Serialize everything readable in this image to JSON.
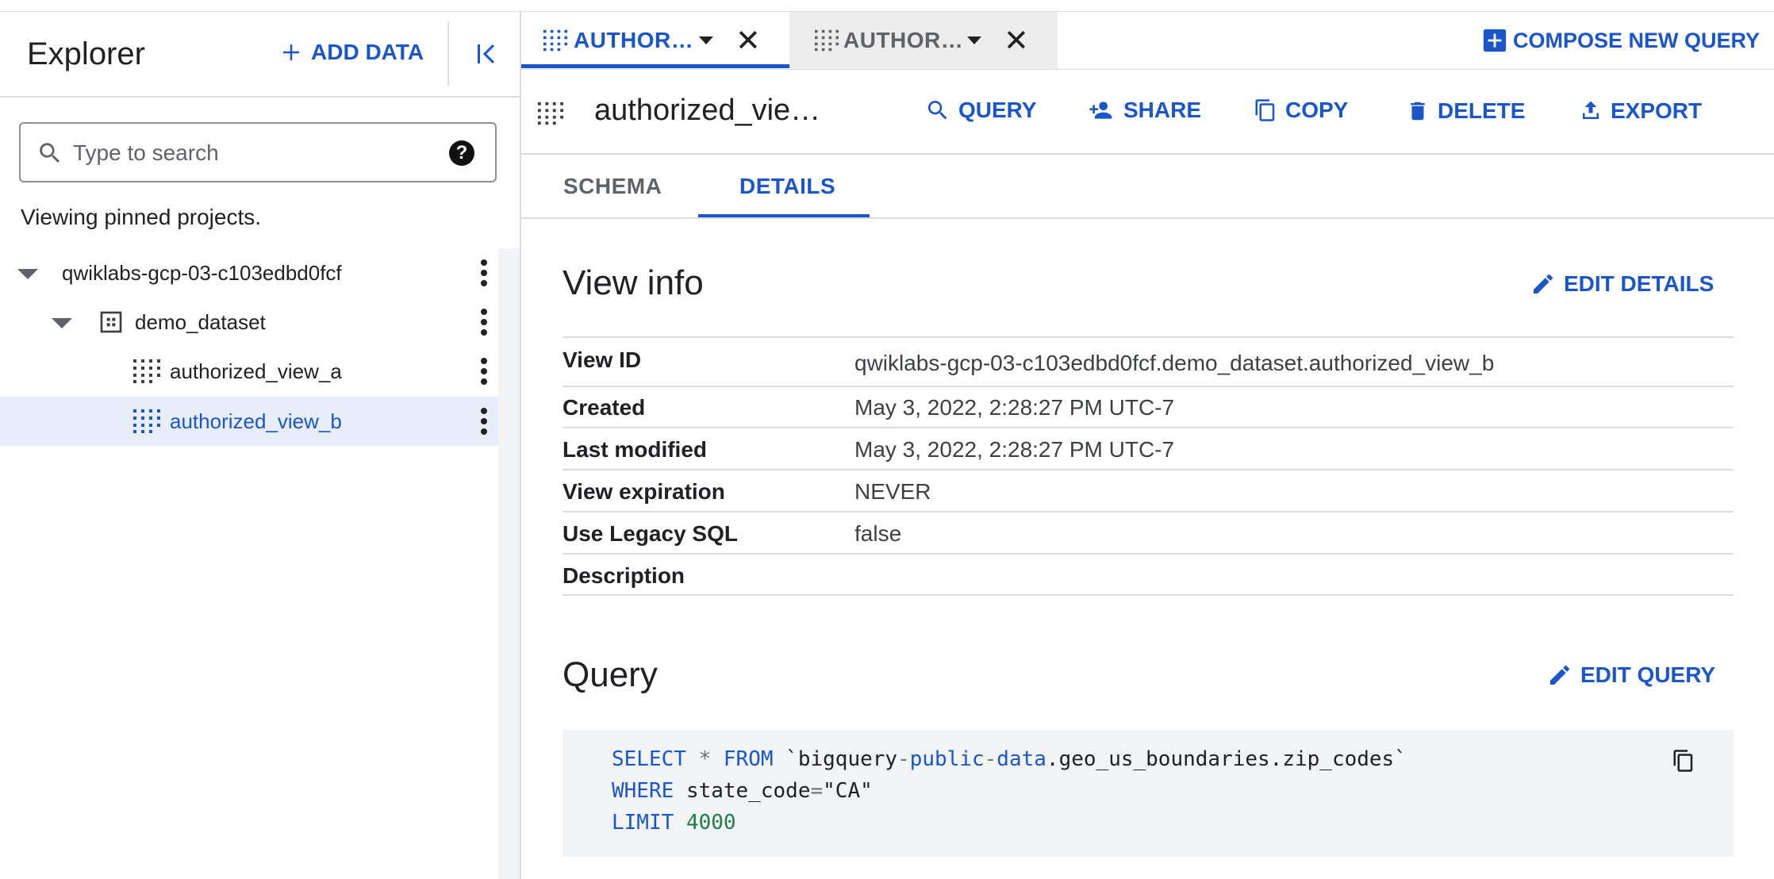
{
  "explorer": {
    "title": "Explorer",
    "add_data_label": "ADD DATA",
    "search_placeholder": "Type to search",
    "help_glyph": "?",
    "viewing_text": "Viewing pinned projects.",
    "tree": [
      {
        "label": "qwiklabs-gcp-03-c103edbd0fcf",
        "type": "project",
        "expanded": true
      },
      {
        "label": "demo_dataset",
        "type": "dataset",
        "expanded": true
      },
      {
        "label": "authorized_view_a",
        "type": "view",
        "selected": false
      },
      {
        "label": "authorized_view_b",
        "type": "view",
        "selected": true
      }
    ]
  },
  "tabs": [
    {
      "label": "AUTHOR…",
      "active": true
    },
    {
      "label": "AUTHOR…",
      "active": false
    }
  ],
  "close_glyph": "✕",
  "compose_label": "COMPOSE NEW QUERY",
  "toolbar": {
    "title": "authorized_vie…",
    "buttons": [
      {
        "label": "QUERY",
        "icon": "search-icon"
      },
      {
        "label": "SHARE",
        "icon": "person-add-icon"
      },
      {
        "label": "COPY",
        "icon": "copy-icon"
      },
      {
        "label": "DELETE",
        "icon": "trash-icon"
      },
      {
        "label": "EXPORT",
        "icon": "upload-icon"
      }
    ]
  },
  "subtabs": [
    {
      "label": "SCHEMA",
      "active": false
    },
    {
      "label": "DETAILS",
      "active": true
    }
  ],
  "view_info": {
    "title": "View info",
    "edit_label": "EDIT DETAILS",
    "rows": [
      {
        "label": "View ID",
        "value": "qwiklabs-gcp-03-c103edbd0fcf.demo_dataset.authorized_view_b"
      },
      {
        "label": "Created",
        "value": "May 3, 2022, 2:28:27 PM UTC-7"
      },
      {
        "label": "Last modified",
        "value": "May 3, 2022, 2:28:27 PM UTC-7"
      },
      {
        "label": "View expiration",
        "value": "NEVER"
      },
      {
        "label": "Use Legacy SQL",
        "value": "false"
      },
      {
        "label": "Description",
        "value": ""
      }
    ]
  },
  "query": {
    "title": "Query",
    "edit_label": "EDIT QUERY",
    "code": {
      "select": "SELECT",
      "star": "*",
      "from": "FROM",
      "tick": "`",
      "t_part1": "bigquery",
      "dash": "-",
      "t_part2": "public",
      "t_part3": "data",
      "t_rest": ".geo_us_boundaries.zip_codes",
      "where": "WHERE",
      "cond_field": "state_code",
      "eq": "=",
      "cond_value": "\"CA\"",
      "limit": "LIMIT",
      "limit_value": "4000"
    }
  },
  "colors": {
    "accent": "#1a56c9",
    "selected_bg": "#e8edfb",
    "code_bg": "#f1f3f4"
  }
}
